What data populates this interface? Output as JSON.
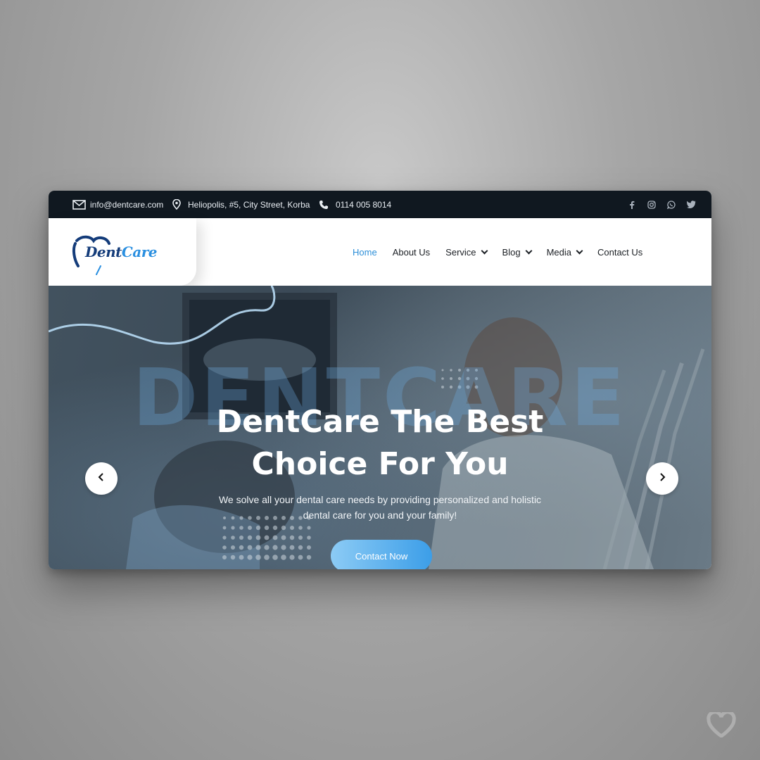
{
  "topbar": {
    "email": "info@dentcare.com",
    "address": "Heliopolis, #5, City Street, Korba",
    "phone": "0114 005 8014",
    "social_icons": [
      "facebook-icon",
      "instagram-icon",
      "whatsapp-icon",
      "twitter-icon"
    ],
    "background": "#101820"
  },
  "header": {
    "logo": {
      "part1": "Dent",
      "part2": "Care"
    },
    "nav": [
      {
        "label": "Home",
        "active": true,
        "dropdown": false
      },
      {
        "label": "About Us",
        "active": false,
        "dropdown": false
      },
      {
        "label": "Service",
        "active": false,
        "dropdown": true
      },
      {
        "label": "Blog",
        "active": false,
        "dropdown": true
      },
      {
        "label": "Media",
        "active": false,
        "dropdown": true
      },
      {
        "label": "Contact Us",
        "active": false,
        "dropdown": false
      }
    ]
  },
  "hero": {
    "watermark": "DENTCARE",
    "title_line1": "DentCare The Best",
    "title_line2": "Choice For You",
    "subtitle": "We solve all your dental care needs by providing personalized and holistic dental care for you and your family!",
    "cta_label": "Contact Now",
    "prev_icon": "chevron-left-icon",
    "next_icon": "chevron-right-icon"
  },
  "colors": {
    "accent": "#2d8fd8",
    "brand_dark": "#143c7a",
    "cta_start": "#8ccbf5",
    "cta_end": "#3c9ee8"
  }
}
